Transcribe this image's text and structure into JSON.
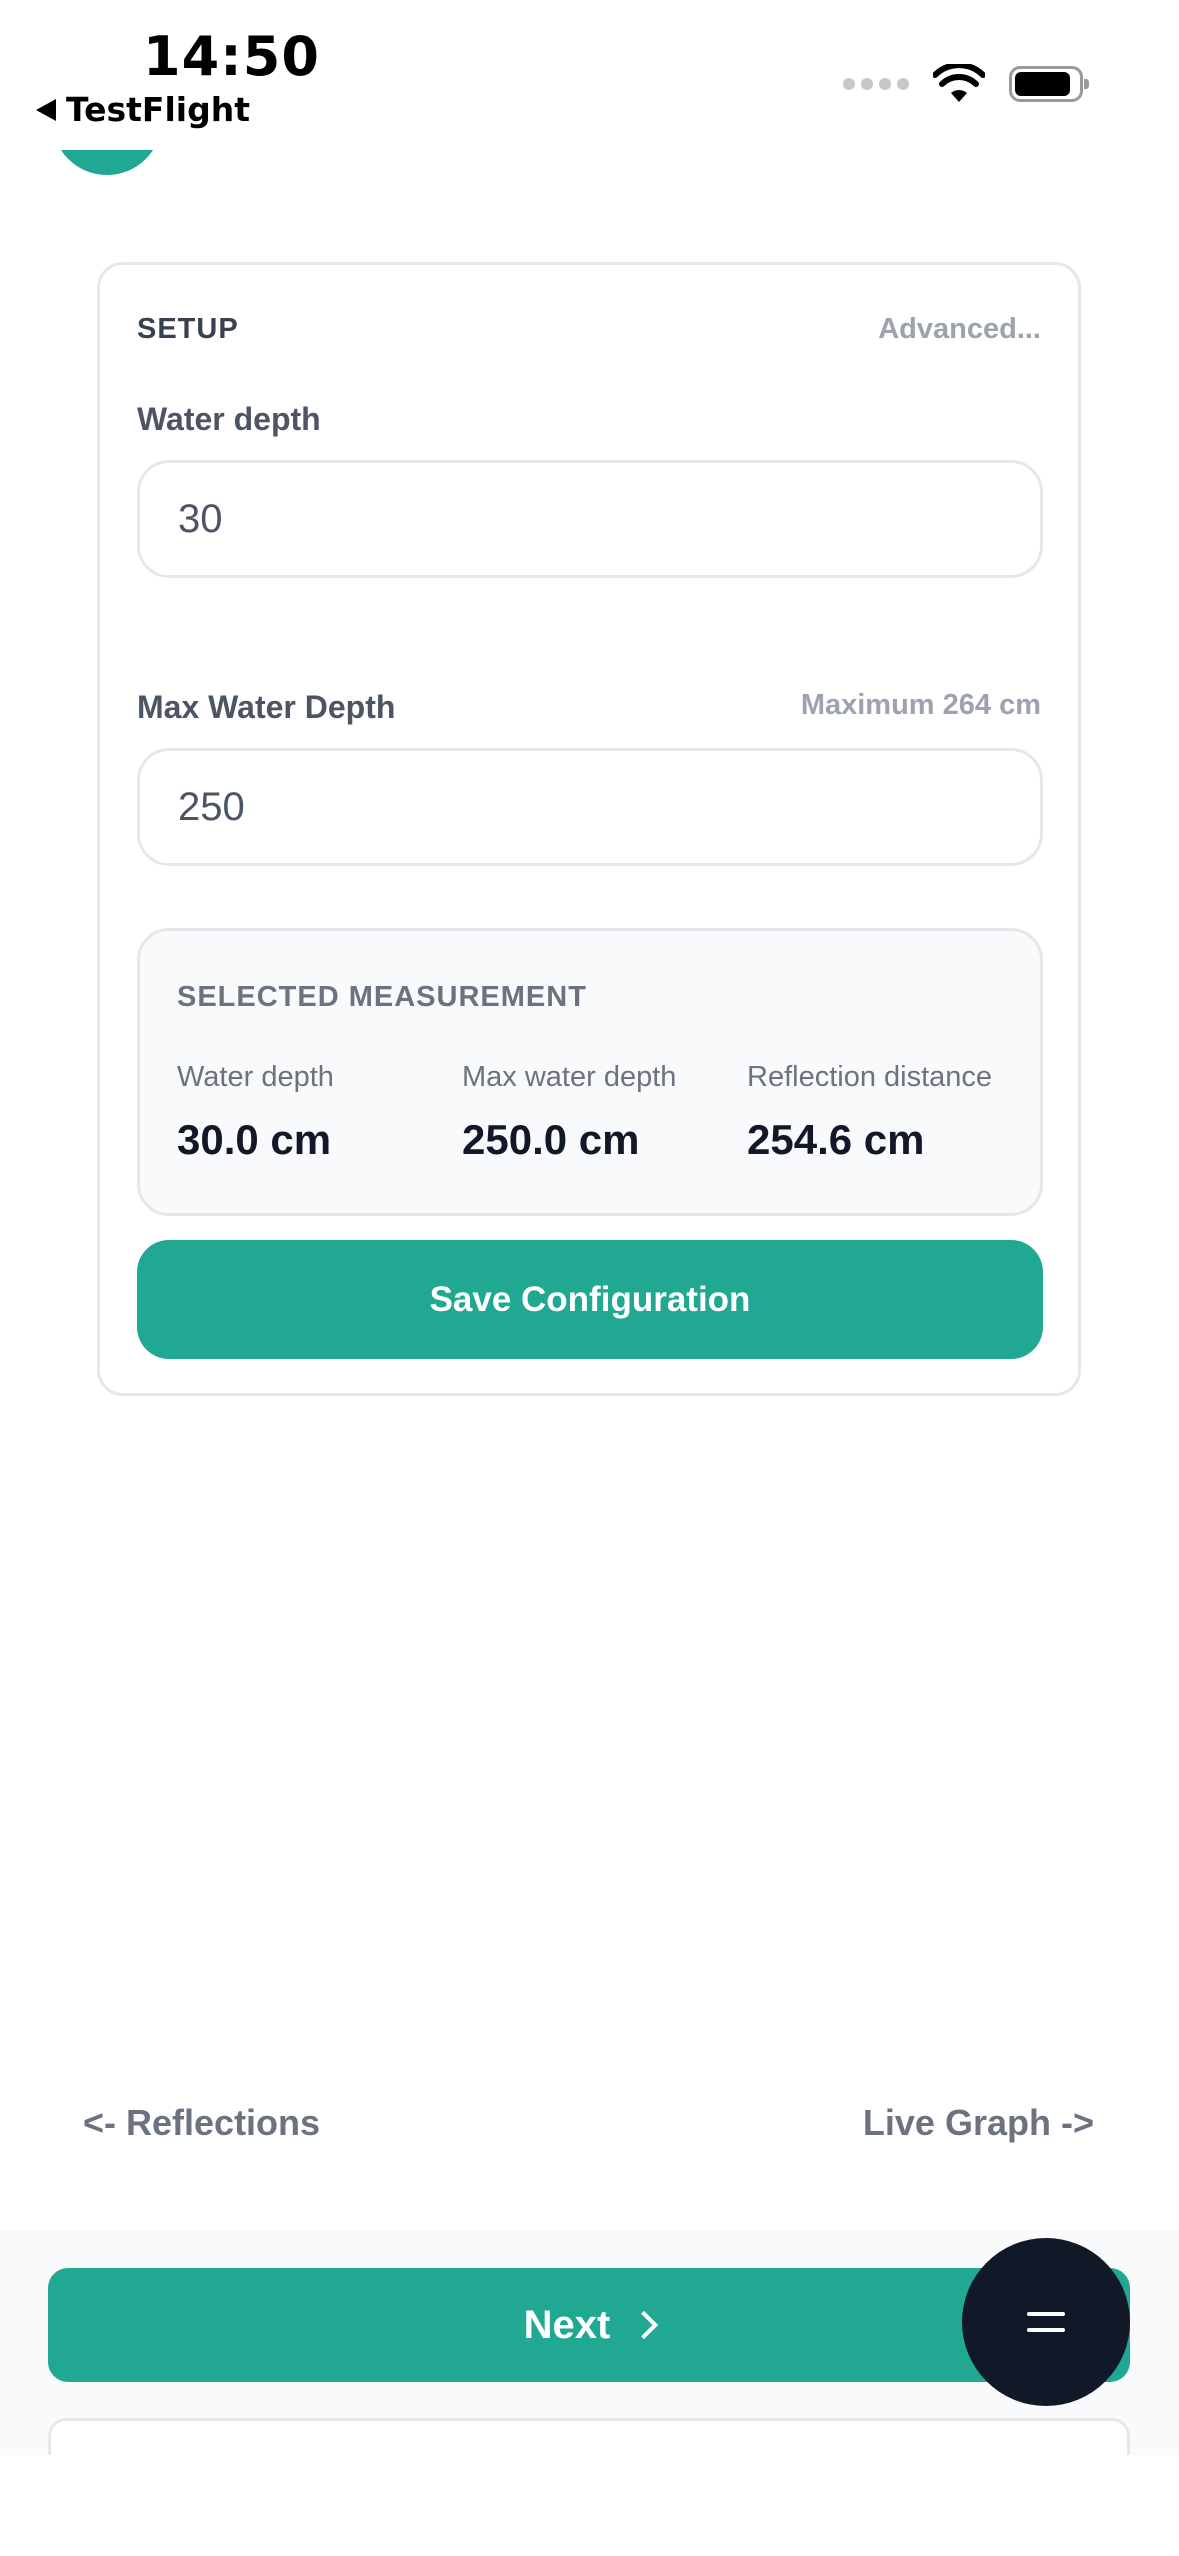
{
  "status_bar": {
    "time": "14:50",
    "back_label": "TestFlight"
  },
  "setup": {
    "title": "SETUP",
    "advanced_label": "Advanced...",
    "water_depth": {
      "label": "Water depth",
      "value": "30"
    },
    "max_water_depth": {
      "label": "Max Water Depth",
      "hint": "Maximum 264 cm",
      "value": "250"
    },
    "selected_measurement": {
      "title": "SELECTED MEASUREMENT",
      "items": [
        {
          "label": "Water depth",
          "value": "30.0 cm"
        },
        {
          "label": "Max water depth",
          "value": "250.0 cm"
        },
        {
          "label": "Reflection distance",
          "value": "254.6 cm"
        }
      ]
    },
    "save_label": "Save Configuration"
  },
  "navigation": {
    "prev_label": "<- Reflections",
    "next_link_label": "Live Graph ->",
    "next_button_label": "Next"
  },
  "colors": {
    "accent": "#21a892",
    "fab": "#111827"
  }
}
